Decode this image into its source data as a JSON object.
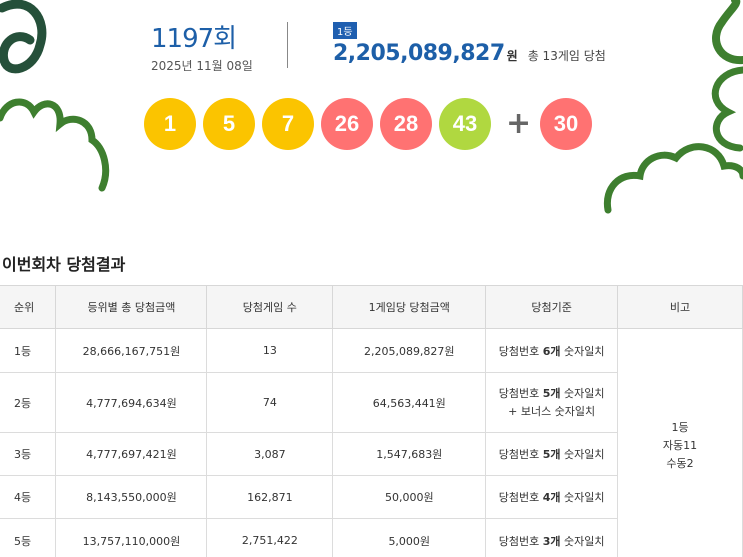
{
  "draw": {
    "round_number": "1197",
    "round_suffix": "회",
    "date": "2025년 11월 08일"
  },
  "first_prize": {
    "badge": "1등",
    "amount": "2,205,089,827",
    "unit": "원",
    "winners_text": "총 13게임 당첨"
  },
  "balls": {
    "main": [
      "1",
      "5",
      "7",
      "26",
      "28",
      "43"
    ],
    "plus": "+",
    "bonus": "30"
  },
  "colors": {
    "ball_yellow": "#fbc400",
    "ball_red": "#ff7272",
    "ball_green": "#b0d840",
    "accent_blue": "#1d5fa8",
    "deco_green": "#3e7f2f"
  },
  "section_title": "이번회차 당첨결과",
  "table": {
    "headers": [
      "순위",
      "등위별 총 당첨금액",
      "당첨게임 수",
      "1게임당 당첨금액",
      "당첨기준",
      "비고"
    ],
    "rows": [
      {
        "rank": "1등",
        "total": "28,666,167,751원",
        "games": "13",
        "per_game": "2,205,089,827원",
        "criteria_pre": "당첨번호 ",
        "criteria_bold": "6개",
        "criteria_post": " 숫자일치",
        "criteria_line2": ""
      },
      {
        "rank": "2등",
        "total": "4,777,694,634원",
        "games": "74",
        "per_game": "64,563,441원",
        "criteria_pre": "당첨번호 ",
        "criteria_bold": "5개",
        "criteria_post": " 숫자일치",
        "criteria_line2": "+ 보너스 숫자일치"
      },
      {
        "rank": "3등",
        "total": "4,777,697,421원",
        "games": "3,087",
        "per_game": "1,547,683원",
        "criteria_pre": "당첨번호 ",
        "criteria_bold": "5개",
        "criteria_post": " 숫자일치",
        "criteria_line2": ""
      },
      {
        "rank": "4등",
        "total": "8,143,550,000원",
        "games": "162,871",
        "per_game": "50,000원",
        "criteria_pre": "당첨번호 ",
        "criteria_bold": "4개",
        "criteria_post": " 숫자일치",
        "criteria_line2": ""
      },
      {
        "rank": "5등",
        "total": "13,757,110,000원",
        "games": "2,751,422",
        "per_game": "5,000원",
        "criteria_pre": "당첨번호 ",
        "criteria_bold": "3개",
        "criteria_post": " 숫자일치",
        "criteria_line2": ""
      }
    ],
    "note": {
      "line1": "1등",
      "line2": "자동11",
      "line3": "수동2"
    }
  }
}
